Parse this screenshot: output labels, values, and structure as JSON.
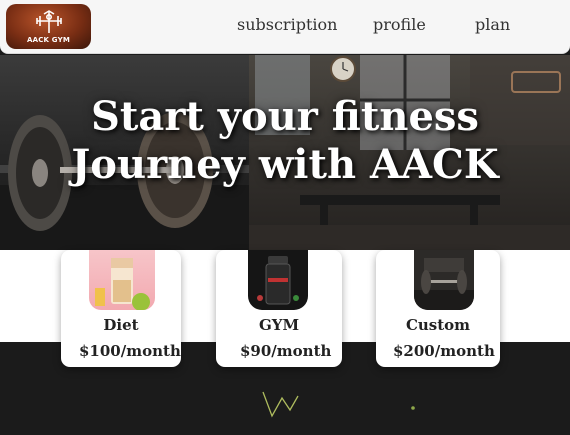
{
  "nav": {
    "logo_text": "AACK GYM",
    "links": [
      {
        "label": "subscription"
      },
      {
        "label": "profile"
      },
      {
        "label": "plan"
      }
    ]
  },
  "hero": {
    "title_line1": "Start your fitness",
    "title_line2": "Journey with AACK"
  },
  "plans": [
    {
      "name": "Diet",
      "price": "$100/month"
    },
    {
      "name": "GYM",
      "price": "$90/month"
    },
    {
      "name": "Custom",
      "price": "$200/month"
    }
  ],
  "colors": {
    "nav_bg": "#f6f6f6",
    "logo_bg": "#7a2e14",
    "page_bg": "#1b1b1b",
    "neon_accent": "#c8d86a"
  }
}
